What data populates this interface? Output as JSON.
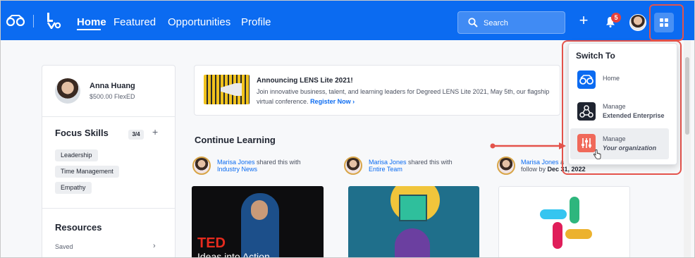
{
  "nav": {
    "links": [
      "Home",
      "Featured",
      "Opportunities",
      "Profile"
    ],
    "search_placeholder": "Search",
    "notification_count": "5"
  },
  "profile": {
    "name": "Anna Huang",
    "balance": "$500.00 FlexED"
  },
  "focus_skills": {
    "title": "Focus Skills",
    "count": "3/4",
    "chips": [
      "Leadership",
      "Time Management",
      "Empathy"
    ]
  },
  "resources": {
    "title": "Resources",
    "item": "Saved"
  },
  "announcement": {
    "title": "Announcing LENS Lite 2021!",
    "body": "Join innovative business, talent, and learning leaders for Degreed LENS Lite 2021, May 5th, our flagship virtual conference.",
    "link": "Register Now"
  },
  "continue_learning": {
    "title": "Continue Learning",
    "shares": [
      {
        "user": "Marisa Jones",
        "action": "shared this with",
        "target": "Industry News"
      },
      {
        "user": "Marisa Jones",
        "action": "shared this with",
        "target": "Entire Team"
      },
      {
        "user": "Marisa Jones",
        "action": "a",
        "target_prefix": "follow by",
        "target": "Dec 31, 2022"
      }
    ],
    "thumb_ted_logo": "TED",
    "thumb_ted_sub": "Ideas into Action"
  },
  "switch_to": {
    "title": "Switch To",
    "items": [
      {
        "label": "Home",
        "sub": "",
        "icon": "glasses-icon",
        "color": "#0b6bf1"
      },
      {
        "label": "Manage",
        "sub": "Extended Enterprise",
        "icon": "network-icon",
        "color": "#1f2430"
      },
      {
        "label": "Manage",
        "sub": "Your organization",
        "icon": "sliders-icon",
        "color": "#f0695a"
      }
    ]
  },
  "colors": {
    "brand_blue": "#0b6bf1",
    "highlight_red": "#e4534b"
  }
}
